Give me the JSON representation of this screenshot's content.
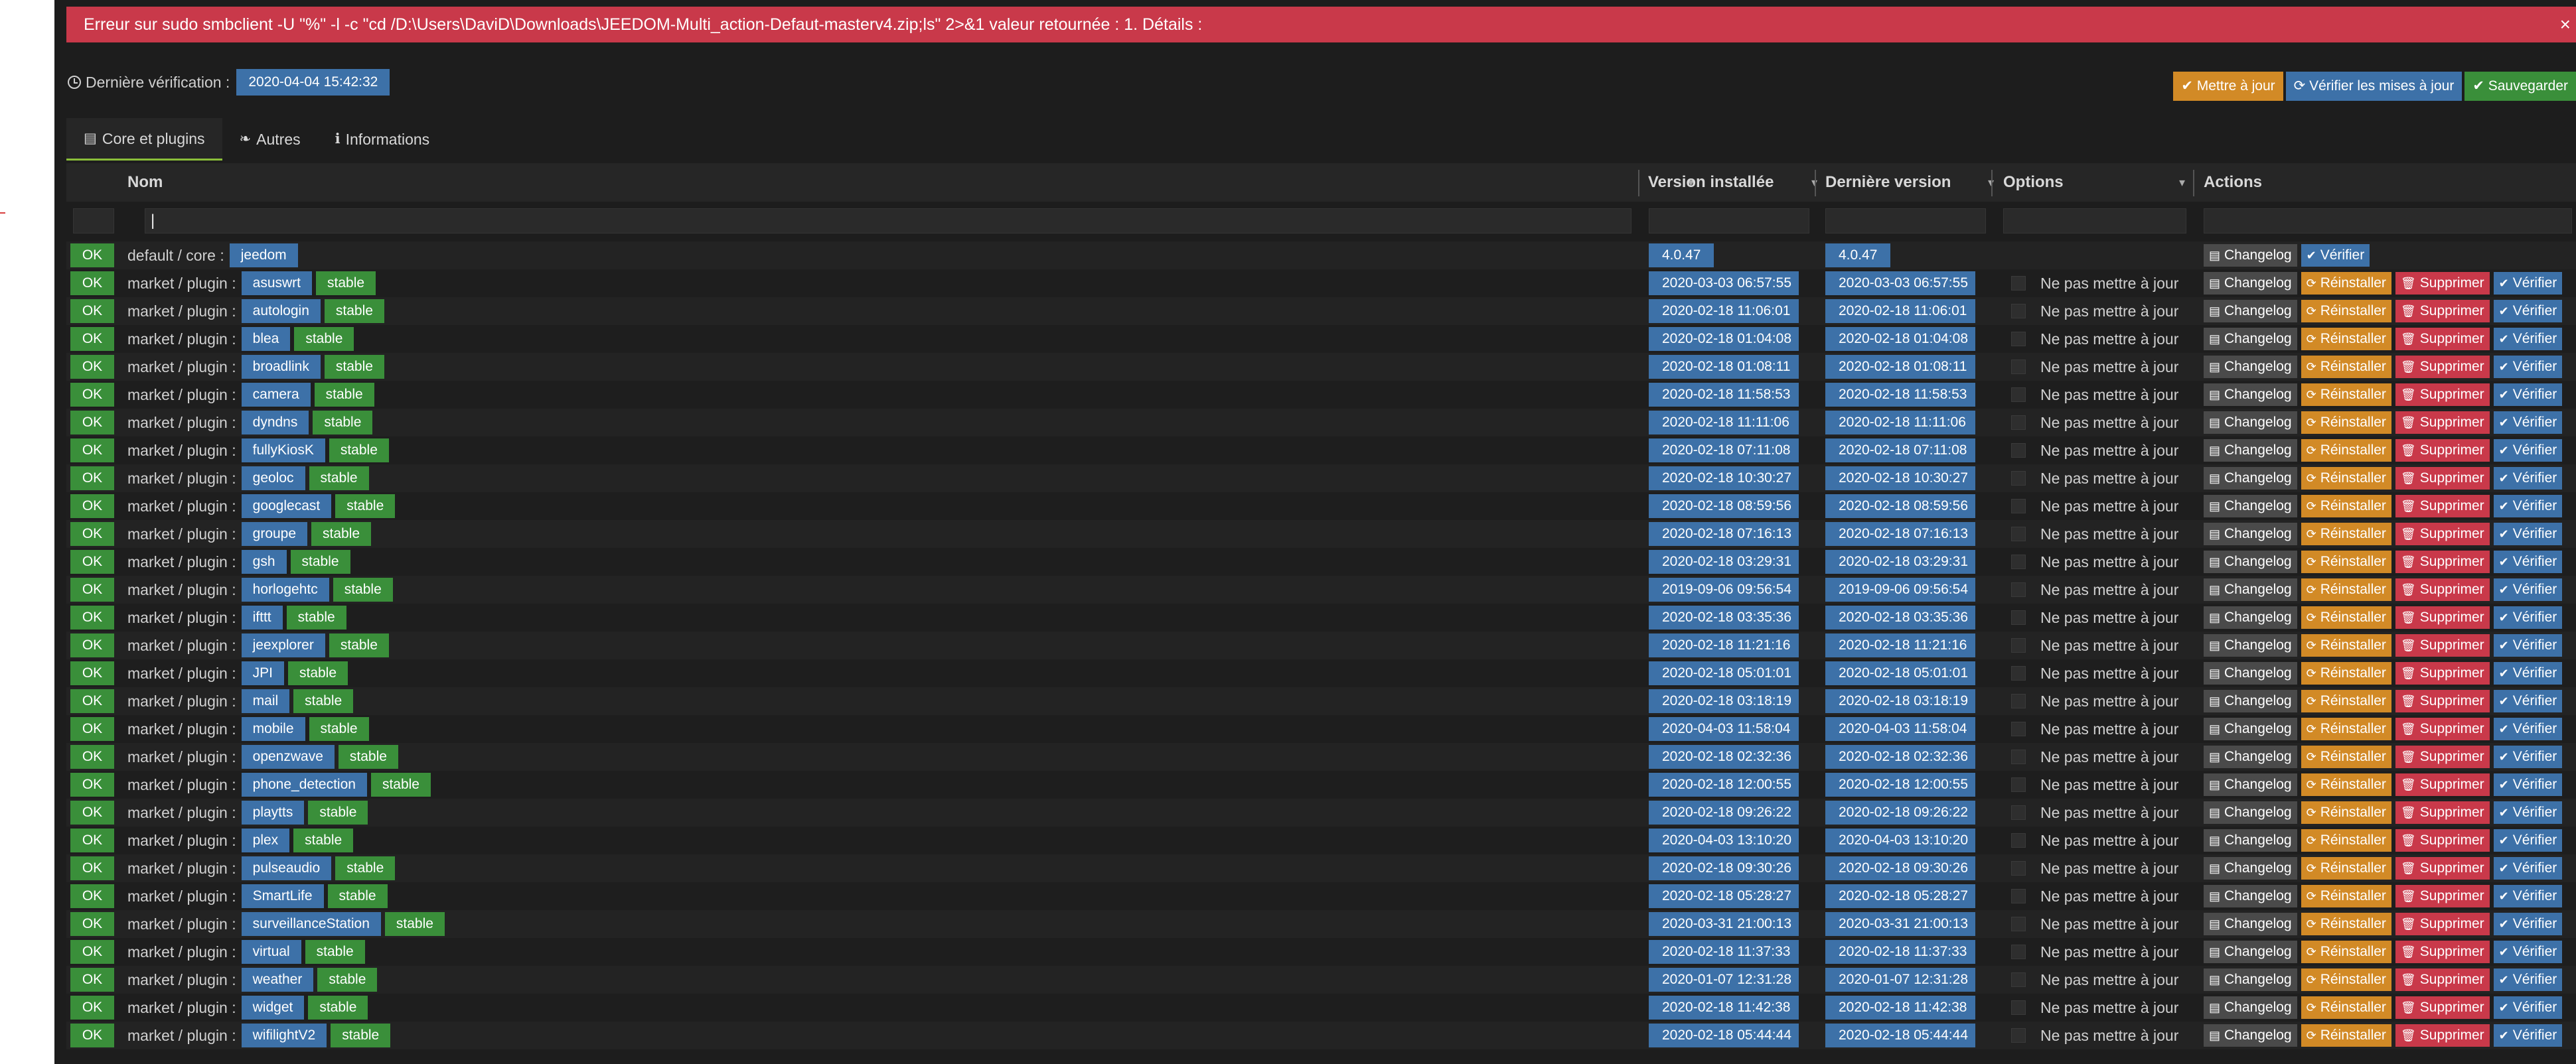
{
  "error": {
    "message": "Erreur sur sudo smbclient -U \"%\" -l -c \"cd /D:\\Users\\DaviD\\Downloads\\JEEDOM-Multi_action-Defaut-masterv4.zip;ls\" 2>&1 valeur retournée : 1. Détails :",
    "close_label": "×"
  },
  "last_check": {
    "label": "Dernière vérification :",
    "value": "2020-04-04 15:42:32"
  },
  "top_buttons": {
    "update": "Mettre à jour",
    "check": "Vérifier les mises à jour",
    "save": "Sauvegarder"
  },
  "tabs": [
    {
      "label": "Core et plugins",
      "icon": "archive-icon"
    },
    {
      "label": "Autres",
      "icon": "leaf-icon"
    },
    {
      "label": "Informations",
      "icon": "info-icon"
    }
  ],
  "columns": {
    "name": "Nom",
    "installed": "Version installée",
    "latest": "Dernière version",
    "options": "Options",
    "actions": "Actions",
    "sort_glyph": "▾"
  },
  "filter": {
    "name_value": "|"
  },
  "labels": {
    "ok": "OK",
    "option": "Ne pas mettre à jour",
    "changelog": "Changelog",
    "reinstall": "Réinstaller",
    "delete": "Supprimer",
    "verify": "Vérifier"
  },
  "core_row": {
    "status": "OK",
    "prefix": "default / core :",
    "name": "jeedom",
    "installed": "4.0.47",
    "latest": "4.0.47"
  },
  "plugins": [
    {
      "prefix": "market / plugin :",
      "name": "asuswrt",
      "channel": "stable",
      "installed": "2020-03-03 06:57:55",
      "latest": "2020-03-03 06:57:55"
    },
    {
      "prefix": "market / plugin :",
      "name": "autologin",
      "channel": "stable",
      "installed": "2020-02-18 11:06:01",
      "latest": "2020-02-18 11:06:01"
    },
    {
      "prefix": "market / plugin :",
      "name": "blea",
      "channel": "stable",
      "installed": "2020-02-18 01:04:08",
      "latest": "2020-02-18 01:04:08"
    },
    {
      "prefix": "market / plugin :",
      "name": "broadlink",
      "channel": "stable",
      "installed": "2020-02-18 01:08:11",
      "latest": "2020-02-18 01:08:11"
    },
    {
      "prefix": "market / plugin :",
      "name": "camera",
      "channel": "stable",
      "installed": "2020-02-18 11:58:53",
      "latest": "2020-02-18 11:58:53"
    },
    {
      "prefix": "market / plugin :",
      "name": "dyndns",
      "channel": "stable",
      "installed": "2020-02-18 11:11:06",
      "latest": "2020-02-18 11:11:06"
    },
    {
      "prefix": "market / plugin :",
      "name": "fullyKiosK",
      "channel": "stable",
      "installed": "2020-02-18 07:11:08",
      "latest": "2020-02-18 07:11:08"
    },
    {
      "prefix": "market / plugin :",
      "name": "geoloc",
      "channel": "stable",
      "installed": "2020-02-18 10:30:27",
      "latest": "2020-02-18 10:30:27"
    },
    {
      "prefix": "market / plugin :",
      "name": "googlecast",
      "channel": "stable",
      "installed": "2020-02-18 08:59:56",
      "latest": "2020-02-18 08:59:56"
    },
    {
      "prefix": "market / plugin :",
      "name": "groupe",
      "channel": "stable",
      "installed": "2020-02-18 07:16:13",
      "latest": "2020-02-18 07:16:13"
    },
    {
      "prefix": "market / plugin :",
      "name": "gsh",
      "channel": "stable",
      "installed": "2020-02-18 03:29:31",
      "latest": "2020-02-18 03:29:31"
    },
    {
      "prefix": "market / plugin :",
      "name": "horlogehtc",
      "channel": "stable",
      "installed": "2019-09-06 09:56:54",
      "latest": "2019-09-06 09:56:54"
    },
    {
      "prefix": "market / plugin :",
      "name": "ifttt",
      "channel": "stable",
      "installed": "2020-02-18 03:35:36",
      "latest": "2020-02-18 03:35:36"
    },
    {
      "prefix": "market / plugin :",
      "name": "jeexplorer",
      "channel": "stable",
      "installed": "2020-02-18 11:21:16",
      "latest": "2020-02-18 11:21:16"
    },
    {
      "prefix": "market / plugin :",
      "name": "JPI",
      "channel": "stable",
      "installed": "2020-02-18 05:01:01",
      "latest": "2020-02-18 05:01:01"
    },
    {
      "prefix": "market / plugin :",
      "name": "mail",
      "channel": "stable",
      "installed": "2020-02-18 03:18:19",
      "latest": "2020-02-18 03:18:19"
    },
    {
      "prefix": "market / plugin :",
      "name": "mobile",
      "channel": "stable",
      "installed": "2020-04-03 11:58:04",
      "latest": "2020-04-03 11:58:04"
    },
    {
      "prefix": "market / plugin :",
      "name": "openzwave",
      "channel": "stable",
      "installed": "2020-02-18 02:32:36",
      "latest": "2020-02-18 02:32:36"
    },
    {
      "prefix": "market / plugin :",
      "name": "phone_detection",
      "channel": "stable",
      "installed": "2020-02-18 12:00:55",
      "latest": "2020-02-18 12:00:55"
    },
    {
      "prefix": "market / plugin :",
      "name": "playtts",
      "channel": "stable",
      "installed": "2020-02-18 09:26:22",
      "latest": "2020-02-18 09:26:22"
    },
    {
      "prefix": "market / plugin :",
      "name": "plex",
      "channel": "stable",
      "installed": "2020-04-03 13:10:20",
      "latest": "2020-04-03 13:10:20"
    },
    {
      "prefix": "market / plugin :",
      "name": "pulseaudio",
      "channel": "stable",
      "installed": "2020-02-18 09:30:26",
      "latest": "2020-02-18 09:30:26"
    },
    {
      "prefix": "market / plugin :",
      "name": "SmartLife",
      "channel": "stable",
      "installed": "2020-02-18 05:28:27",
      "latest": "2020-02-18 05:28:27"
    },
    {
      "prefix": "market / plugin :",
      "name": "surveillanceStation",
      "channel": "stable",
      "installed": "2020-03-31 21:00:13",
      "latest": "2020-03-31 21:00:13"
    },
    {
      "prefix": "market / plugin :",
      "name": "virtual",
      "channel": "stable",
      "installed": "2020-02-18 11:37:33",
      "latest": "2020-02-18 11:37:33"
    },
    {
      "prefix": "market / plugin :",
      "name": "weather",
      "channel": "stable",
      "installed": "2020-01-07 12:31:28",
      "latest": "2020-01-07 12:31:28"
    },
    {
      "prefix": "market / plugin :",
      "name": "widget",
      "channel": "stable",
      "installed": "2020-02-18 11:42:38",
      "latest": "2020-02-18 11:42:38"
    },
    {
      "prefix": "market / plugin :",
      "name": "wifilightV2",
      "channel": "stable",
      "installed": "2020-02-18 05:44:44",
      "latest": "2020-02-18 05:44:44"
    }
  ],
  "colors": {
    "background": "#1d1d1d",
    "error": "#c9394a",
    "ok_green": "#3a8f3a",
    "label_blue": "#3d71a8",
    "orange": "#d28a26",
    "tab_accent": "#8bbf3a"
  }
}
